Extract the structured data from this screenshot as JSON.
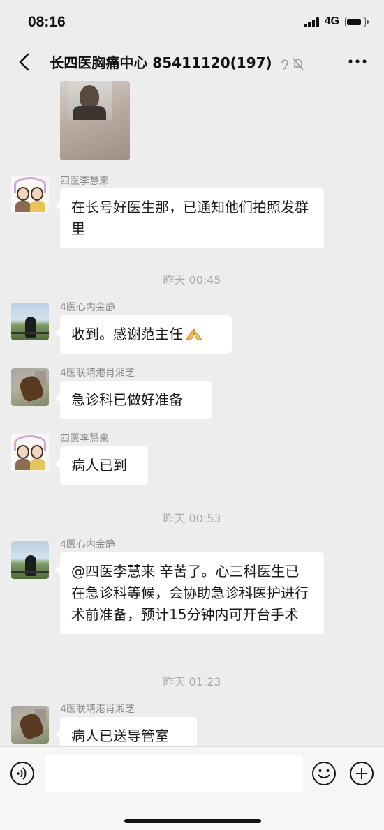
{
  "status_bar": {
    "time": "08:16",
    "network": "4G"
  },
  "header": {
    "title": "长四医胸痛中心 85411120(197)"
  },
  "messages": [
    {
      "sender": "四医李慧来",
      "text": "在长号好医生那，已通知他们拍照发群里"
    },
    {
      "time": "昨天 00:45"
    },
    {
      "sender": "4医心内金静",
      "text": "收到。感谢范主任"
    },
    {
      "sender": "4医联靖港肖湘芝",
      "text": "急诊科已做好准备"
    },
    {
      "sender": "四医李慧来",
      "text": "病人已到"
    },
    {
      "time": "昨天 00:53"
    },
    {
      "sender": "4医心内金静",
      "text": "@四医李慧来 辛苦了。心三科医生已在急诊科等候，会协助急诊科医护进行术前准备，预计15分钟内可开台手术"
    },
    {
      "time": "昨天 01:23"
    },
    {
      "sender": "4医联靖港肖湘芝",
      "text": "病人已送导管室"
    }
  ],
  "input": {
    "placeholder": ""
  },
  "colors": {
    "background": "#ededed",
    "bubble": "#ffffff",
    "meta_text": "#888888",
    "time_separator": "#a9a9a9"
  }
}
